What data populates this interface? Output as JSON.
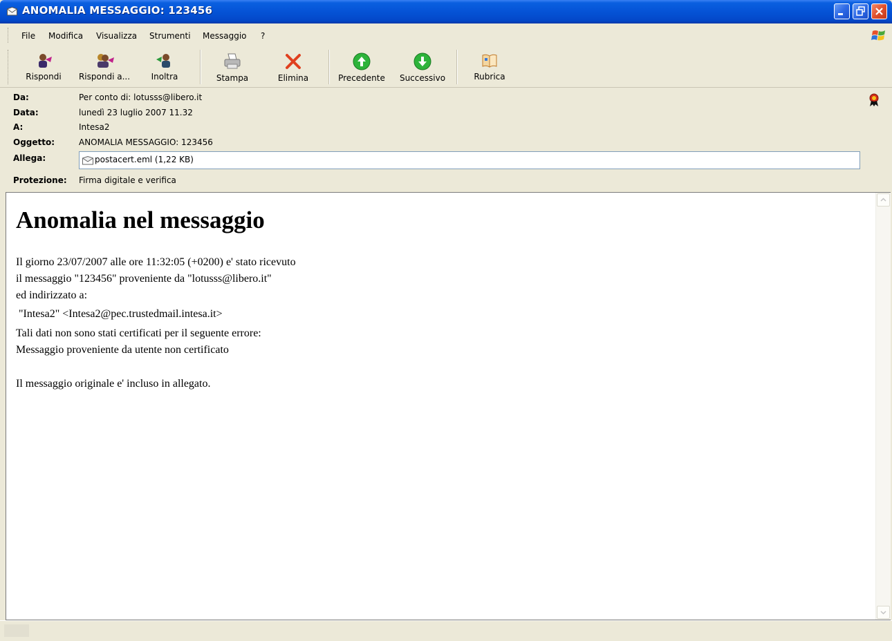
{
  "window": {
    "title": "ANOMALIA MESSAGGIO: 123456"
  },
  "menu": {
    "items": [
      "File",
      "Modifica",
      "Visualizza",
      "Strumenti",
      "Messaggio",
      "?"
    ]
  },
  "toolbar": {
    "reply": "Rispondi",
    "reply_all": "Rispondi a...",
    "forward": "Inoltra",
    "print": "Stampa",
    "delete": "Elimina",
    "previous": "Precedente",
    "next": "Successivo",
    "addressbook": "Rubrica"
  },
  "header": {
    "from_label": "Da:",
    "from_value": "Per conto di: lotusss@libero.it",
    "date_label": "Data:",
    "date_value": "lunedì 23 luglio 2007 11.32",
    "to_label": "A:",
    "to_value": "Intesa2",
    "subject_label": "Oggetto:",
    "subject_value": "ANOMALIA MESSAGGIO: 123456",
    "attach_label": "Allega:",
    "attach_value": "postacert.eml (1,22 KB)",
    "security_label": "Protezione:",
    "security_value": "Firma digitale e verifica"
  },
  "body": {
    "title": "Anomalia nel messaggio",
    "line1": "Il giorno 23/07/2007 alle ore 11:32:05 (+0200) e' stato ricevuto",
    "line2": "il messaggio \"123456\" proveniente da \"lotusss@libero.it\"",
    "line3": "ed indirizzato a:",
    "line4": " \"Intesa2\" <Intesa2@pec.trustedmail.intesa.it>",
    "line5": "Tali dati non sono stati certificati per il seguente errore:",
    "line6": "Messaggio proveniente da utente non certificato",
    "line7": "Il messaggio originale e' incluso in allegato."
  },
  "colors": {
    "titlebar": "#0553d6",
    "chrome": "#ece9d8",
    "delete_icon": "#e0401f",
    "nav_icon": "#2db33a"
  },
  "icons": {
    "title": "envelope-icon",
    "reply": "reply-person-icon",
    "reply_all": "reply-all-people-icon",
    "forward": "forward-person-icon",
    "print": "printer-icon",
    "delete": "red-x-icon",
    "previous": "green-up-arrow-icon",
    "next": "green-down-arrow-icon",
    "addressbook": "address-book-icon",
    "attachment": "envelope-attachment-icon",
    "security": "certificate-seal-icon"
  }
}
